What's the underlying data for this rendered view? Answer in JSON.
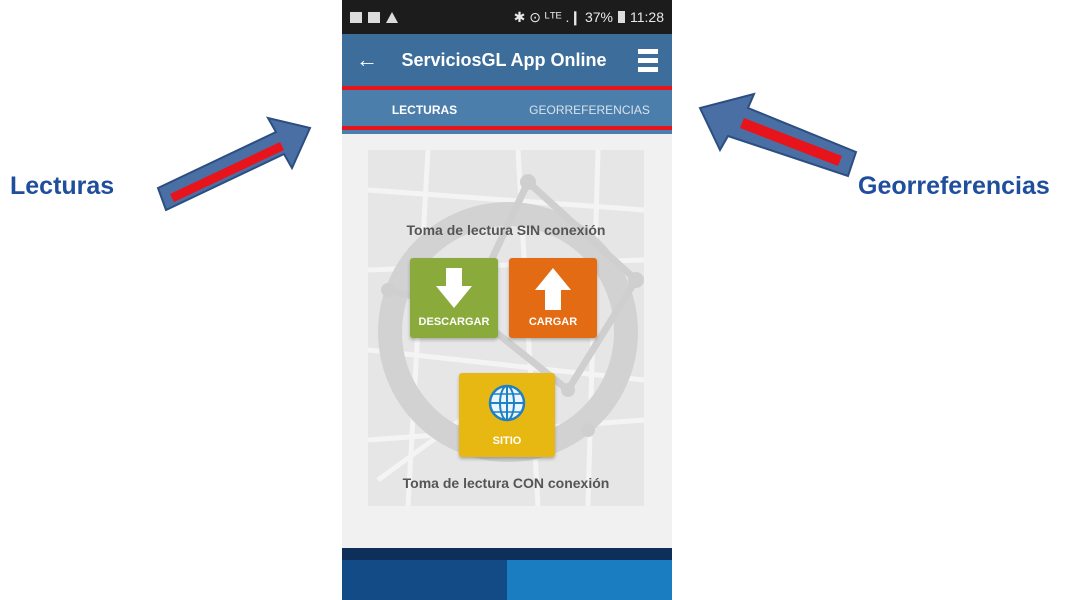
{
  "callouts": {
    "left": "Lecturas",
    "right": "Georreferencias"
  },
  "status_bar": {
    "right_text": "✱ ⊙ ᴸᵀᴱ .❙ 37%",
    "time": "11:28"
  },
  "app_bar": {
    "title": "ServiciosGL App Online"
  },
  "tabs": [
    {
      "label": "LECTURAS"
    },
    {
      "label": "GEORREFERENCIAS"
    }
  ],
  "content": {
    "offline_heading": "Toma de lectura SIN conexión",
    "online_heading": "Toma de lectura CON conexión",
    "buttons": {
      "descargar": "DESCARGAR",
      "cargar": "CARGAR",
      "sitio": "SITIO"
    }
  },
  "colors": {
    "app_bar": "#3d6e9b",
    "tab_bar": "#4b7eab",
    "highlight": "#e8141c",
    "callout_text": "#1f4e9c",
    "descargar": "#8aab3b",
    "cargar": "#e36b13",
    "sitio": "#e7b812"
  }
}
